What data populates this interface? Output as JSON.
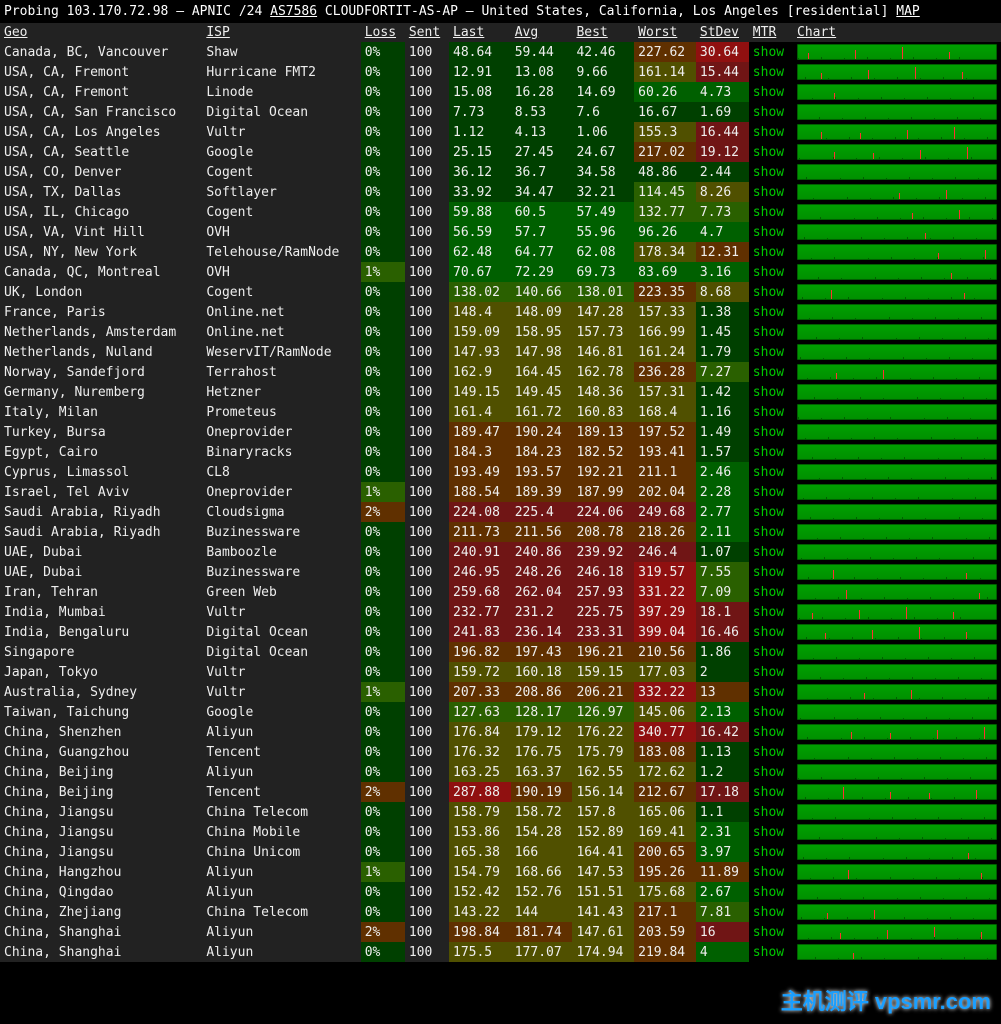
{
  "header": {
    "prefix": "Probing ",
    "ip": "103.170.72.98",
    "reg_prefix": " — APNIC /24 ",
    "asn": "AS7586",
    "asn_name": " CLOUDFORTIT-AS-AP — United States, California, Los Angeles [residential] ",
    "map": "MAP"
  },
  "columns": [
    "Geo",
    "ISP",
    "Loss",
    "Sent",
    "Last",
    "Avg",
    "Best",
    "Worst",
    "StDev",
    "MTR",
    "Chart"
  ],
  "mtr_label": "show",
  "rows": [
    {
      "geo": "Canada, BC, Vancouver",
      "isp": "Shaw",
      "loss": "0%",
      "sent": "100",
      "last": "48.64",
      "avg": "59.44",
      "best": "42.46",
      "worst": "227.62",
      "stdev": "30.64",
      "h": [
        0,
        0,
        0,
        4,
        6
      ]
    },
    {
      "geo": "USA, CA, Fremont",
      "isp": "Hurricane FMT2",
      "loss": "0%",
      "sent": "100",
      "last": "12.91",
      "avg": "13.08",
      "best": "9.66",
      "worst": "161.14",
      "stdev": "15.44",
      "h": [
        0,
        0,
        0,
        3,
        5
      ]
    },
    {
      "geo": "USA, CA, Fremont",
      "isp": "Linode",
      "loss": "0%",
      "sent": "100",
      "last": "15.08",
      "avg": "16.28",
      "best": "14.69",
      "worst": "60.26",
      "stdev": "4.73",
      "h": [
        0,
        0,
        0,
        1,
        1
      ]
    },
    {
      "geo": "USA, CA, San Francisco",
      "isp": "Digital Ocean",
      "loss": "0%",
      "sent": "100",
      "last": "7.73",
      "avg": "8.53",
      "best": "7.6",
      "worst": "16.67",
      "stdev": "1.69",
      "h": [
        0,
        0,
        0,
        0,
        0
      ]
    },
    {
      "geo": "USA, CA, Los Angeles",
      "isp": "Vultr",
      "loss": "0%",
      "sent": "100",
      "last": "1.12",
      "avg": "4.13",
      "best": "1.06",
      "worst": "155.3",
      "stdev": "16.44",
      "h": [
        0,
        0,
        0,
        3,
        5
      ]
    },
    {
      "geo": "USA, CA, Seattle",
      "isp": "Google",
      "loss": "0%",
      "sent": "100",
      "last": "25.15",
      "avg": "27.45",
      "best": "24.67",
      "worst": "217.02",
      "stdev": "19.12",
      "h": [
        0,
        0,
        0,
        4,
        5
      ]
    },
    {
      "geo": "USA, CO, Denver",
      "isp": "Cogent",
      "loss": "0%",
      "sent": "100",
      "last": "36.12",
      "avg": "36.7",
      "best": "34.58",
      "worst": "48.86",
      "stdev": "2.44",
      "h": [
        0,
        0,
        0,
        0,
        0
      ]
    },
    {
      "geo": "USA, TX, Dallas",
      "isp": "Softlayer",
      "loss": "0%",
      "sent": "100",
      "last": "33.92",
      "avg": "34.47",
      "best": "32.21",
      "worst": "114.45",
      "stdev": "8.26",
      "h": [
        0,
        0,
        0,
        2,
        3
      ]
    },
    {
      "geo": "USA, IL, Chicago",
      "isp": "Cogent",
      "loss": "0%",
      "sent": "100",
      "last": "59.88",
      "avg": "60.5",
      "best": "57.49",
      "worst": "132.77",
      "stdev": "7.73",
      "h": [
        1,
        1,
        1,
        2,
        2
      ]
    },
    {
      "geo": "USA, VA, Vint Hill",
      "isp": "OVH",
      "loss": "0%",
      "sent": "100",
      "last": "56.59",
      "avg": "57.7",
      "best": "55.96",
      "worst": "96.26",
      "stdev": "4.7",
      "h": [
        1,
        1,
        1,
        1,
        1
      ]
    },
    {
      "geo": "USA, NY, New York",
      "isp": "Telehouse/RamNode",
      "loss": "0%",
      "sent": "100",
      "last": "62.48",
      "avg": "64.77",
      "best": "62.08",
      "worst": "178.34",
      "stdev": "12.31",
      "h": [
        1,
        1,
        1,
        3,
        4
      ]
    },
    {
      "geo": "Canada, QC, Montreal",
      "isp": "OVH",
      "loss": "1%",
      "sent": "100",
      "last": "70.67",
      "avg": "72.29",
      "best": "69.73",
      "worst": "83.69",
      "stdev": "3.16",
      "h": [
        1,
        1,
        1,
        1,
        1
      ]
    },
    {
      "geo": "UK, London",
      "isp": "Cogent",
      "loss": "0%",
      "sent": "100",
      "last": "138.02",
      "avg": "140.66",
      "best": "138.01",
      "worst": "223.35",
      "stdev": "8.68",
      "h": [
        2,
        2,
        2,
        4,
        3
      ]
    },
    {
      "geo": "France, Paris",
      "isp": "Online.net",
      "loss": "0%",
      "sent": "100",
      "last": "148.4",
      "avg": "148.09",
      "best": "147.28",
      "worst": "157.33",
      "stdev": "1.38",
      "h": [
        3,
        3,
        3,
        3,
        0
      ]
    },
    {
      "geo": "Netherlands, Amsterdam",
      "isp": "Online.net",
      "loss": "0%",
      "sent": "100",
      "last": "159.09",
      "avg": "158.95",
      "best": "157.73",
      "worst": "166.99",
      "stdev": "1.45",
      "h": [
        3,
        3,
        3,
        3,
        0
      ]
    },
    {
      "geo": "Netherlands, Nuland",
      "isp": "WeservIT/RamNode",
      "loss": "0%",
      "sent": "100",
      "last": "147.93",
      "avg": "147.98",
      "best": "146.81",
      "worst": "161.24",
      "stdev": "1.79",
      "h": [
        3,
        3,
        3,
        3,
        0
      ]
    },
    {
      "geo": "Norway, Sandefjord",
      "isp": "Terrahost",
      "loss": "0%",
      "sent": "100",
      "last": "162.9",
      "avg": "164.45",
      "best": "162.78",
      "worst": "236.28",
      "stdev": "7.27",
      "h": [
        3,
        3,
        3,
        4,
        2
      ]
    },
    {
      "geo": "Germany, Nuremberg",
      "isp": "Hetzner",
      "loss": "0%",
      "sent": "100",
      "last": "149.15",
      "avg": "149.45",
      "best": "148.36",
      "worst": "157.31",
      "stdev": "1.42",
      "h": [
        3,
        3,
        3,
        3,
        0
      ]
    },
    {
      "geo": "Italy, Milan",
      "isp": "Prometeus",
      "loss": "0%",
      "sent": "100",
      "last": "161.4",
      "avg": "161.72",
      "best": "160.83",
      "worst": "168.4",
      "stdev": "1.16",
      "h": [
        3,
        3,
        3,
        3,
        0
      ]
    },
    {
      "geo": "Turkey, Bursa",
      "isp": "Oneprovider",
      "loss": "0%",
      "sent": "100",
      "last": "189.47",
      "avg": "190.24",
      "best": "189.13",
      "worst": "197.52",
      "stdev": "1.49",
      "h": [
        4,
        4,
        4,
        4,
        0
      ]
    },
    {
      "geo": "Egypt, Cairo",
      "isp": "Binaryracks",
      "loss": "0%",
      "sent": "100",
      "last": "184.3",
      "avg": "184.23",
      "best": "182.52",
      "worst": "193.41",
      "stdev": "1.57",
      "h": [
        4,
        4,
        4,
        4,
        0
      ]
    },
    {
      "geo": "Cyprus, Limassol",
      "isp": "CL8",
      "loss": "0%",
      "sent": "100",
      "last": "193.49",
      "avg": "193.57",
      "best": "192.21",
      "worst": "211.1",
      "stdev": "2.46",
      "h": [
        4,
        4,
        4,
        4,
        1
      ]
    },
    {
      "geo": "Israel, Tel Aviv",
      "isp": "Oneprovider",
      "loss": "1%",
      "sent": "100",
      "last": "188.54",
      "avg": "189.39",
      "best": "187.99",
      "worst": "202.04",
      "stdev": "2.28",
      "h": [
        4,
        4,
        4,
        4,
        1
      ]
    },
    {
      "geo": "Saudi Arabia, Riyadh",
      "isp": "Cloudsigma",
      "loss": "2%",
      "sent": "100",
      "last": "224.08",
      "avg": "225.4",
      "best": "224.06",
      "worst": "249.68",
      "stdev": "2.77",
      "h": [
        5,
        5,
        5,
        5,
        1
      ]
    },
    {
      "geo": "Saudi Arabia, Riyadh",
      "isp": "Buzinessware",
      "loss": "0%",
      "sent": "100",
      "last": "211.73",
      "avg": "211.56",
      "best": "208.78",
      "worst": "218.26",
      "stdev": "2.11",
      "h": [
        4,
        4,
        4,
        4,
        1
      ]
    },
    {
      "geo": "UAE, Dubai",
      "isp": "Bamboozle",
      "loss": "0%",
      "sent": "100",
      "last": "240.91",
      "avg": "240.86",
      "best": "239.92",
      "worst": "246.4",
      "stdev": "1.07",
      "h": [
        5,
        5,
        5,
        5,
        0
      ]
    },
    {
      "geo": "UAE, Dubai",
      "isp": "Buzinessware",
      "loss": "0%",
      "sent": "100",
      "last": "246.95",
      "avg": "248.26",
      "best": "246.18",
      "worst": "319.57",
      "stdev": "7.55",
      "h": [
        5,
        5,
        5,
        6,
        2
      ]
    },
    {
      "geo": "Iran, Tehran",
      "isp": "Green Web",
      "loss": "0%",
      "sent": "100",
      "last": "259.68",
      "avg": "262.04",
      "best": "257.93",
      "worst": "331.22",
      "stdev": "7.09",
      "h": [
        5,
        5,
        5,
        6,
        2
      ]
    },
    {
      "geo": "India, Mumbai",
      "isp": "Vultr",
      "loss": "0%",
      "sent": "100",
      "last": "232.77",
      "avg": "231.2",
      "best": "225.75",
      "worst": "397.29",
      "stdev": "18.1",
      "h": [
        5,
        5,
        5,
        6,
        5
      ]
    },
    {
      "geo": "India, Bengaluru",
      "isp": "Digital Ocean",
      "loss": "0%",
      "sent": "100",
      "last": "241.83",
      "avg": "236.14",
      "best": "233.31",
      "worst": "399.04",
      "stdev": "16.46",
      "h": [
        5,
        5,
        5,
        6,
        5
      ]
    },
    {
      "geo": "Singapore",
      "isp": "Digital Ocean",
      "loss": "0%",
      "sent": "100",
      "last": "196.82",
      "avg": "197.43",
      "best": "196.21",
      "worst": "210.56",
      "stdev": "1.86",
      "h": [
        4,
        4,
        4,
        4,
        0
      ]
    },
    {
      "geo": "Japan, Tokyo",
      "isp": "Vultr",
      "loss": "0%",
      "sent": "100",
      "last": "159.72",
      "avg": "160.18",
      "best": "159.15",
      "worst": "177.03",
      "stdev": "2",
      "h": [
        3,
        3,
        3,
        3,
        0
      ]
    },
    {
      "geo": "Australia, Sydney",
      "isp": "Vultr",
      "loss": "1%",
      "sent": "100",
      "last": "207.33",
      "avg": "208.86",
      "best": "206.21",
      "worst": "332.22",
      "stdev": "13",
      "h": [
        4,
        4,
        4,
        6,
        4
      ]
    },
    {
      "geo": "Taiwan, Taichung",
      "isp": "Google",
      "loss": "0%",
      "sent": "100",
      "last": "127.63",
      "avg": "128.17",
      "best": "126.97",
      "worst": "145.06",
      "stdev": "2.13",
      "h": [
        2,
        2,
        2,
        3,
        1
      ]
    },
    {
      "geo": "China, Shenzhen",
      "isp": "Aliyun",
      "loss": "0%",
      "sent": "100",
      "last": "176.84",
      "avg": "179.12",
      "best": "176.22",
      "worst": "340.77",
      "stdev": "16.42",
      "h": [
        3,
        3,
        3,
        6,
        5
      ]
    },
    {
      "geo": "China, Guangzhou",
      "isp": "Tencent",
      "loss": "0%",
      "sent": "100",
      "last": "176.32",
      "avg": "176.75",
      "best": "175.79",
      "worst": "183.08",
      "stdev": "1.13",
      "h": [
        3,
        3,
        3,
        4,
        0
      ]
    },
    {
      "geo": "China, Beijing",
      "isp": "Aliyun",
      "loss": "0%",
      "sent": "100",
      "last": "163.25",
      "avg": "163.37",
      "best": "162.55",
      "worst": "172.62",
      "stdev": "1.2",
      "h": [
        3,
        3,
        3,
        3,
        0
      ]
    },
    {
      "geo": "China, Beijing",
      "isp": "Tencent",
      "loss": "2%",
      "sent": "100",
      "last": "287.88",
      "avg": "190.19",
      "best": "156.14",
      "worst": "212.67",
      "stdev": "17.18",
      "h": [
        6,
        4,
        3,
        4,
        5
      ]
    },
    {
      "geo": "China, Jiangsu",
      "isp": "China Telecom",
      "loss": "0%",
      "sent": "100",
      "last": "158.79",
      "avg": "158.72",
      "best": "157.8",
      "worst": "165.06",
      "stdev": "1.1",
      "h": [
        3,
        3,
        3,
        3,
        0
      ]
    },
    {
      "geo": "China, Jiangsu",
      "isp": "China Mobile",
      "loss": "0%",
      "sent": "100",
      "last": "153.86",
      "avg": "154.28",
      "best": "152.89",
      "worst": "169.41",
      "stdev": "2.31",
      "h": [
        3,
        3,
        3,
        3,
        1
      ]
    },
    {
      "geo": "China, Jiangsu",
      "isp": "China Unicom",
      "loss": "0%",
      "sent": "100",
      "last": "165.38",
      "avg": "166",
      "best": "164.41",
      "worst": "200.65",
      "stdev": "3.97",
      "h": [
        3,
        3,
        3,
        4,
        1
      ]
    },
    {
      "geo": "China, Hangzhou",
      "isp": "Aliyun",
      "loss": "1%",
      "sent": "100",
      "last": "154.79",
      "avg": "168.66",
      "best": "147.53",
      "worst": "195.26",
      "stdev": "11.89",
      "h": [
        3,
        3,
        3,
        4,
        4
      ]
    },
    {
      "geo": "China, Qingdao",
      "isp": "Aliyun",
      "loss": "0%",
      "sent": "100",
      "last": "152.42",
      "avg": "152.76",
      "best": "151.51",
      "worst": "175.68",
      "stdev": "2.67",
      "h": [
        3,
        3,
        3,
        3,
        1
      ]
    },
    {
      "geo": "China, Zhejiang",
      "isp": "China Telecom",
      "loss": "0%",
      "sent": "100",
      "last": "143.22",
      "avg": "144",
      "best": "141.43",
      "worst": "217.1",
      "stdev": "7.81",
      "h": [
        3,
        3,
        3,
        4,
        2
      ]
    },
    {
      "geo": "China, Shanghai",
      "isp": "Aliyun",
      "loss": "2%",
      "sent": "100",
      "last": "198.84",
      "avg": "181.74",
      "best": "147.61",
      "worst": "203.59",
      "stdev": "16",
      "h": [
        4,
        4,
        3,
        4,
        5
      ]
    },
    {
      "geo": "China, Shanghai",
      "isp": "Aliyun",
      "loss": "0%",
      "sent": "100",
      "last": "175.5",
      "avg": "177.07",
      "best": "174.94",
      "worst": "219.84",
      "stdev": "4",
      "h": [
        3,
        3,
        3,
        4,
        1
      ]
    }
  ],
  "watermark": "主机测评 vpsmr.com"
}
